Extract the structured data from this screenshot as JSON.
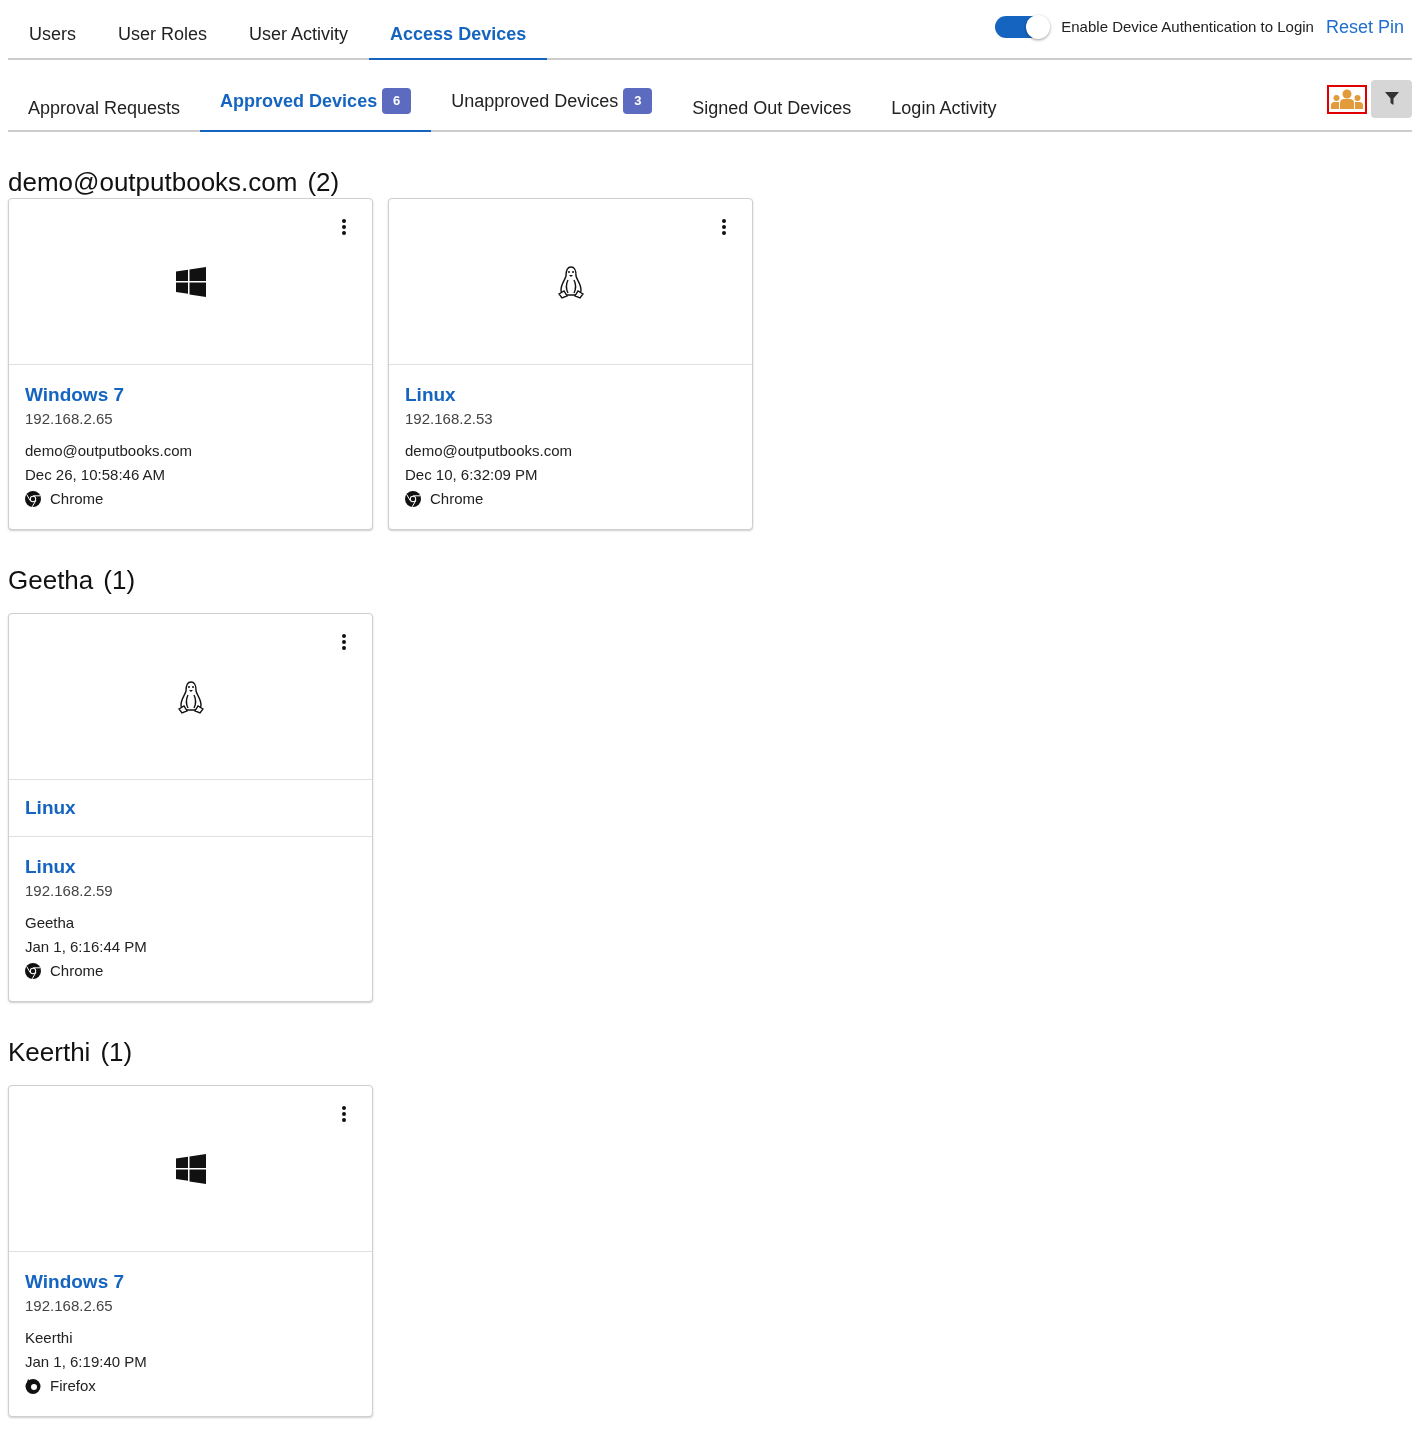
{
  "main_tabs": [
    {
      "label": "Users",
      "selected": false
    },
    {
      "label": "User Roles",
      "selected": false
    },
    {
      "label": "User Activity",
      "selected": false
    },
    {
      "label": "Access Devices",
      "selected": true
    }
  ],
  "device_auth": {
    "label": "Enable Device Authentication to Login",
    "on": true
  },
  "reset_pin": "Reset Pin",
  "sub_tabs": [
    {
      "label": "Approval Requests",
      "selected": false
    },
    {
      "label": "Approved Devices",
      "count": "6",
      "selected": true
    },
    {
      "label": "Unapproved Devices",
      "count": "3",
      "selected": false
    },
    {
      "label": "Signed Out Devices",
      "selected": false
    },
    {
      "label": "Login Activity",
      "selected": false
    }
  ],
  "groups": [
    {
      "title": "demo@outputbooks.com",
      "count": "(2)",
      "devices": [
        {
          "kind": "windows",
          "name": "Windows 7",
          "ip": "192.168.2.65",
          "user": "demo@outputbooks.com",
          "time": "Dec 26, 10:58:46 AM",
          "browser": {
            "kind": "chrome",
            "name": "Chrome"
          }
        },
        {
          "kind": "linux",
          "name": "Linux",
          "ip": "192.168.2.53",
          "user": "demo@outputbooks.com",
          "time": "Dec 10, 6:32:09 PM",
          "browser": {
            "kind": "chrome",
            "name": "Chrome"
          }
        }
      ]
    },
    {
      "title": "Geetha",
      "count": "(1)",
      "devices": [
        {
          "kind": "linux",
          "label": "Linux",
          "name": "Linux",
          "ip": "192.168.2.59",
          "user": "Geetha",
          "time": "Jan 1, 6:16:44 PM",
          "browser": {
            "kind": "chrome",
            "name": "Chrome"
          }
        }
      ]
    },
    {
      "title": "Keerthi",
      "count": "(1)",
      "devices": [
        {
          "kind": "windows",
          "name": "Windows 7",
          "ip": "192.168.2.65",
          "user": "Keerthi",
          "time": "Jan 1, 6:19:40 PM",
          "browser": {
            "kind": "firefox",
            "name": "Firefox"
          }
        }
      ]
    }
  ]
}
